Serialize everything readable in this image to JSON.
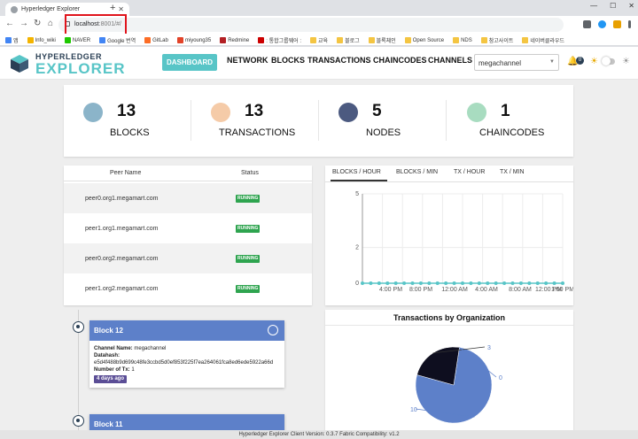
{
  "browser": {
    "tab_title": "Hyperledger Explorer",
    "url_host": "localhost",
    "url_rest": ":8001/#/",
    "bookmarks": [
      "앱",
      "Info_wiki",
      "NAVER",
      "Google 번역",
      "GitLab",
      "miyoung35",
      "Redmine",
      ": 통합그룹웨어 :",
      "교육",
      "블로그",
      "블록체인",
      "Open Source",
      "NDS",
      "참고사이트",
      "네이버클라우드"
    ]
  },
  "header": {
    "logo_top": "HYPERLEDGER",
    "logo_bottom": "EXPLORER",
    "nav": [
      "DASHBOARD",
      "NETWORK",
      "BLOCKS",
      "TRANSACTIONS",
      "CHAINCODES",
      "CHANNELS"
    ],
    "channel": "megachannel",
    "notifications": "0"
  },
  "stats": [
    {
      "value": "13",
      "label": "BLOCKS",
      "color": "#8bb4c9",
      "icon": "cube-icon"
    },
    {
      "value": "13",
      "label": "TRANSACTIONS",
      "color": "#f5cba8",
      "icon": "list-icon"
    },
    {
      "value": "5",
      "label": "NODES",
      "color": "#4c5a80",
      "icon": "users-icon"
    },
    {
      "value": "1",
      "label": "CHAINCODES",
      "color": "#a8dcc0",
      "icon": "handshake-icon"
    }
  ],
  "peers": {
    "col_name": "Peer Name",
    "col_status": "Status",
    "rows": [
      {
        "name": "peer0.org1.megamart.com",
        "status": "RUNNING"
      },
      {
        "name": "peer1.org1.megamart.com",
        "status": "RUNNING"
      },
      {
        "name": "peer0.org2.megamart.com",
        "status": "RUNNING"
      },
      {
        "name": "peer1.org2.megamart.com",
        "status": "RUNNING"
      }
    ]
  },
  "chart_tabs": [
    "BLOCKS / HOUR",
    "BLOCKS / MIN",
    "TX / HOUR",
    "TX / MIN"
  ],
  "chart_data": [
    {
      "type": "line",
      "yticks": [
        "0",
        "2",
        "5"
      ],
      "ylim": [
        0,
        5
      ],
      "xticks": [
        "4:00 PM",
        "8:00 PM",
        "12:00 AM",
        "4:00 AM",
        "8:00 AM",
        "12:00 PM",
        "1:00 PM"
      ],
      "series": [
        {
          "values": [
            0,
            0,
            0,
            0,
            0,
            0,
            0,
            0,
            0,
            0,
            0,
            0,
            0,
            0,
            0,
            0,
            0,
            0,
            0,
            0,
            0,
            0,
            0,
            0,
            0
          ]
        }
      ],
      "color": "#58c5c7"
    },
    {
      "type": "pie",
      "title": "Transactions by Organization",
      "series": [
        {
          "values": [
            10,
            3,
            0
          ]
        }
      ],
      "labels": [
        "10",
        "3",
        "0"
      ],
      "colors": [
        "#5d80c9",
        "#0e0e1f",
        "#5d80c9"
      ]
    }
  ],
  "blocks": [
    {
      "title": "Block 12",
      "channel_label": "Channel Name:",
      "channel": "megachannel",
      "hash_label": "Datahash:",
      "hash": "e5d4f488b9d699c48fe3ccbd5d0ef853f225f7ea264061fca8ed6ede5922a66d",
      "tx_label": "Number of Tx:",
      "tx": "1",
      "age": "4 days ago"
    },
    {
      "title": "Block 11"
    }
  ],
  "footer": "Hyperledger Explorer Client Version: 0.3.7    Fabric Compatibility: v1.2"
}
